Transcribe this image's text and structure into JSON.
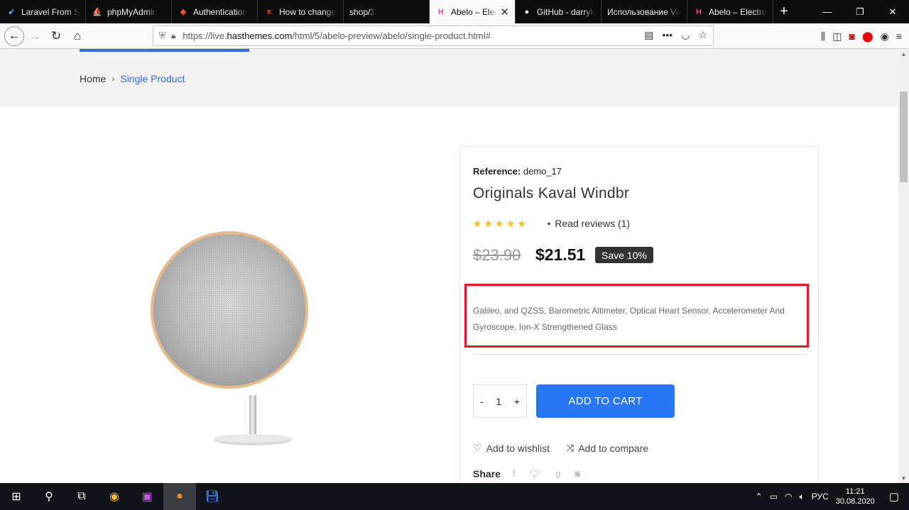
{
  "browser": {
    "tabs": [
      {
        "title": "Laravel From Sc",
        "icon": "laravel-icon",
        "active": false
      },
      {
        "title": "phpMyAdmin",
        "icon": "phpmyadmin-icon",
        "active": false
      },
      {
        "title": "Authentication",
        "icon": "laravel-icon",
        "active": false
      },
      {
        "title": "How to change",
        "icon": "stackoverflow-icon",
        "active": false
      },
      {
        "title": "shop/3",
        "icon": "",
        "active": false
      },
      {
        "title": "Abelo – Elect",
        "icon": "abelo-icon",
        "active": true
      },
      {
        "title": "GitHub - darryld",
        "icon": "github-icon",
        "active": false
      },
      {
        "title": "Использование Vie",
        "icon": "doc-icon",
        "active": false
      },
      {
        "title": "Abelo – Electron",
        "icon": "abelo-icon",
        "active": false
      }
    ],
    "url_prefix": "https://live.",
    "url_domain": "hasthemes.com",
    "url_path": "/html/5/abelo-preview/abelo/single-product.html#"
  },
  "breadcrumb": {
    "home": "Home",
    "separator": "›",
    "current": "Single Product"
  },
  "product": {
    "reference_label": "Reference:",
    "reference_value": "demo_17",
    "title": "Originals Kaval Windbr",
    "rating": 5,
    "stars": "★★★★★",
    "reviews_label": "Read reviews (1)",
    "old_price": "$23.90",
    "price": "$21.51",
    "save_badge": "Save 10%",
    "description": "Galileo, and QZSS, Barometric Altimeter, Optical Heart Sensor, Accelerometer And Gyroscope, Ion-X Strengthened Glass",
    "qty_minus": "-",
    "qty_value": "1",
    "qty_plus": "+",
    "add_to_cart": "ADD TO CART",
    "wishlist": "Add to wishlist",
    "compare": "Add to compare",
    "share": "Share"
  },
  "taskbar": {
    "lang": "РУС",
    "time": "11:21",
    "date": "30.08.2020"
  },
  "colors": {
    "accent": "#2877f5",
    "highlight_box": "#dd1c24",
    "star": "#f4c01e"
  }
}
